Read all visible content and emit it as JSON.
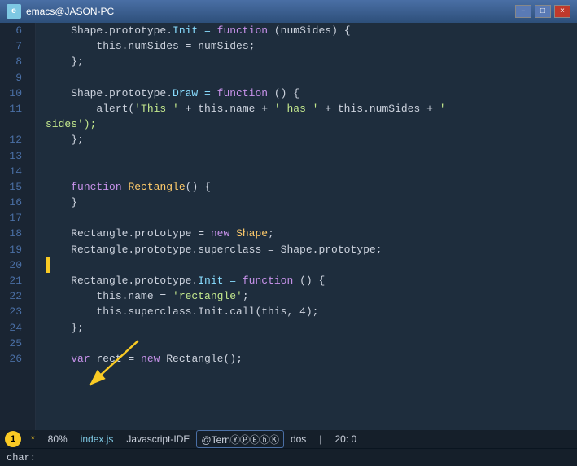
{
  "titleBar": {
    "icon": "e",
    "title": "emacs@JASON-PC",
    "minLabel": "–",
    "maxLabel": "□",
    "closeLabel": "×"
  },
  "lines": [
    {
      "num": "6",
      "tokens": [
        {
          "t": "    Shape.prototype.",
          "c": "plain"
        },
        {
          "t": "Init",
          "c": "prop"
        },
        {
          "t": " = ",
          "c": "op"
        },
        {
          "t": "function",
          "c": "kw"
        },
        {
          "t": " (numSides) {",
          "c": "plain"
        }
      ]
    },
    {
      "num": "7",
      "tokens": [
        {
          "t": "        this.numSides = numSides;",
          "c": "plain"
        }
      ]
    },
    {
      "num": "8",
      "tokens": [
        {
          "t": "    };",
          "c": "plain"
        }
      ]
    },
    {
      "num": "9",
      "tokens": []
    },
    {
      "num": "10",
      "tokens": [
        {
          "t": "    Shape.prototype.",
          "c": "plain"
        },
        {
          "t": "Draw",
          "c": "prop"
        },
        {
          "t": " = ",
          "c": "op"
        },
        {
          "t": "function",
          "c": "kw"
        },
        {
          "t": " () {",
          "c": "plain"
        }
      ]
    },
    {
      "num": "11",
      "tokens": [
        {
          "t": "        alert(",
          "c": "plain"
        },
        {
          "t": "'This '",
          "c": "str"
        },
        {
          "t": " + this.name + ",
          "c": "plain"
        },
        {
          "t": "' has '",
          "c": "str"
        },
        {
          "t": " + this.numSides + ",
          "c": "plain"
        },
        {
          "t": "'",
          "c": "str"
        }
      ]
    },
    {
      "num": "",
      "tokens": [
        {
          "t": "sides');",
          "c": "str"
        }
      ],
      "continuation": true
    },
    {
      "num": "12",
      "tokens": [
        {
          "t": "    };",
          "c": "plain"
        }
      ]
    },
    {
      "num": "13",
      "tokens": []
    },
    {
      "num": "14",
      "tokens": []
    },
    {
      "num": "15",
      "tokens": [
        {
          "t": "    ",
          "c": "plain"
        },
        {
          "t": "function",
          "c": "kw"
        },
        {
          "t": " ",
          "c": "plain"
        },
        {
          "t": "Rectangle",
          "c": "cls"
        },
        {
          "t": "() {",
          "c": "plain"
        }
      ]
    },
    {
      "num": "16",
      "tokens": [
        {
          "t": "    }",
          "c": "plain"
        }
      ]
    },
    {
      "num": "17",
      "tokens": []
    },
    {
      "num": "18",
      "tokens": [
        {
          "t": "    Rectangle.prototype = ",
          "c": "plain"
        },
        {
          "t": "new",
          "c": "kw"
        },
        {
          "t": " ",
          "c": "plain"
        },
        {
          "t": "Shape",
          "c": "cls"
        },
        {
          "t": ";",
          "c": "plain"
        }
      ]
    },
    {
      "num": "19",
      "tokens": [
        {
          "t": "    Rectangle.prototype.superclass = Shape.prototype;",
          "c": "plain"
        }
      ]
    },
    {
      "num": "20",
      "tokens": [],
      "marker": true
    },
    {
      "num": "21",
      "tokens": [
        {
          "t": "    Rectangle.prototype.",
          "c": "plain"
        },
        {
          "t": "Init",
          "c": "prop"
        },
        {
          "t": " = ",
          "c": "op"
        },
        {
          "t": "function",
          "c": "kw"
        },
        {
          "t": " () {",
          "c": "plain"
        }
      ]
    },
    {
      "num": "22",
      "tokens": [
        {
          "t": "        this.name = ",
          "c": "plain"
        },
        {
          "t": "'rectangle'",
          "c": "str"
        },
        {
          "t": ";",
          "c": "plain"
        }
      ]
    },
    {
      "num": "23",
      "tokens": [
        {
          "t": "        this.superclass.Init.call(this, 4);",
          "c": "plain"
        }
      ]
    },
    {
      "num": "24",
      "tokens": [
        {
          "t": "    };",
          "c": "plain"
        }
      ]
    },
    {
      "num": "25",
      "tokens": []
    },
    {
      "num": "26",
      "tokens": [
        {
          "t": "    ",
          "c": "plain"
        },
        {
          "t": "var",
          "c": "kw"
        },
        {
          "t": " rect = ",
          "c": "plain"
        },
        {
          "t": "new",
          "c": "kw"
        },
        {
          "t": " Rectangle();",
          "c": "plain"
        }
      ]
    }
  ],
  "statusBar": {
    "circleNum": "1",
    "asterisk": "*",
    "lineInfo": "80%",
    "filename": "index.js",
    "mode": "Javascript-IDE",
    "plugin": "@TernⓎⓅⒺⓗⓀ",
    "encoding": "dos",
    "position": "20: 0"
  },
  "bottomBar": {
    "label": "char:"
  }
}
